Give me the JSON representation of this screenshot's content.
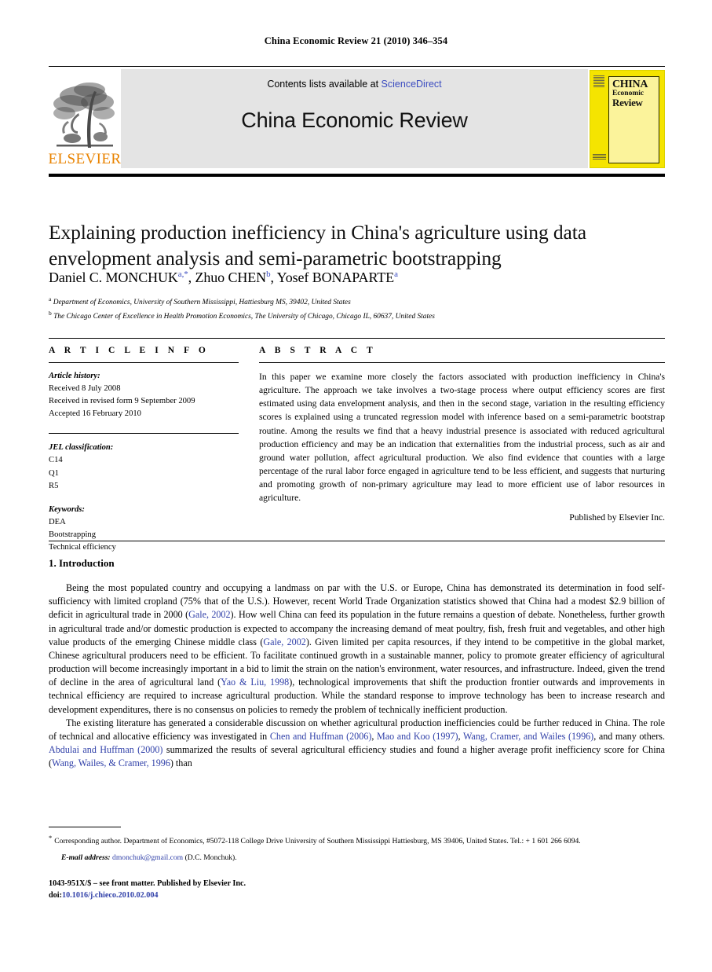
{
  "running_head": "China Economic Review 21 (2010) 346–354",
  "masthead": {
    "publisher_name": "ELSEVIER",
    "publisher_logo_icon": "elsevier-tree-icon",
    "contents_prefix": "Contents lists available at ",
    "contents_link": "ScienceDirect",
    "journal_name": "China Economic Review",
    "cover": {
      "line1": "CHINA",
      "line2": "Economic",
      "line3": "Review",
      "background_color": "#F5E400"
    }
  },
  "article": {
    "title": "Explaining production inefficiency in China's agriculture using data envelopment analysis and semi-parametric bootstrapping",
    "authors": [
      {
        "name": "Daniel C. MONCHUK",
        "marks": "a,*"
      },
      {
        "name": "Zhuo CHEN",
        "marks": "b"
      },
      {
        "name": "Yosef BONAPARTE",
        "marks": "a"
      }
    ],
    "affiliations": [
      {
        "mark": "a",
        "text": "Department of Economics, University of Southern Mississippi, Hattiesburg MS, 39402, United States"
      },
      {
        "mark": "b",
        "text": "The Chicago Center of Excellence in Health Promotion Economics, The University of Chicago, Chicago IL, 60637, United States"
      }
    ]
  },
  "info": {
    "heading": "A R T I C L E  I N F O",
    "history_label": "Article history:",
    "history": [
      "Received 8 July 2008",
      "Received in revised form 9 September 2009",
      "Accepted 16 February 2010"
    ],
    "jel_label": "JEL classification:",
    "jel_codes": [
      "C14",
      "Q1",
      "R5"
    ],
    "keywords_label": "Keywords:",
    "keywords": [
      "DEA",
      "Bootstrapping",
      "Technical efficiency"
    ]
  },
  "abstract": {
    "heading": "A B S T R A C T",
    "text": "In this paper we examine more closely the factors associated with production inefficiency in China's agriculture. The approach we take involves a two-stage process where output efficiency scores are first estimated using data envelopment analysis, and then in the second stage, variation in the resulting efficiency scores is explained using a truncated regression model with inference based on a semi-parametric bootstrap routine. Among the results we find that a heavy industrial presence is associated with reduced agricultural production efficiency and may be an indication that externalities from the industrial process, such as air and ground water pollution, affect agricultural production. We also find evidence that counties with a large percentage of the rural labor force engaged in agriculture tend to be less efficient, and suggests that nurturing and promoting growth of non-primary agriculture may lead to more efficient use of labor resources in agriculture.",
    "publisher_line": "Published by Elsevier Inc."
  },
  "body": {
    "section_heading": "1. Introduction",
    "paragraph1_a": "Being the most populated country and occupying a landmass on par with the U.S. or Europe, China has demonstrated its determination in food self-sufficiency with limited cropland (75% that of the U.S.). However, recent World Trade Organization statistics showed that China had a modest $2.9 billion of deficit in agricultural trade in 2000 (",
    "cite_gale_1": "Gale, 2002",
    "paragraph1_b": "). How well China can feed its population in the future remains a question of debate. Nonetheless, further growth in agricultural trade and/or domestic production is expected to accompany the increasing demand of meat poultry, fish, fresh fruit and vegetables, and other high value products of the emerging Chinese middle class (",
    "cite_gale_2": "Gale, 2002",
    "paragraph1_c": "). Given limited per capita resources, if they intend to be competitive in the global market, Chinese agricultural producers need to be efficient. To facilitate continued growth in a sustainable manner, policy to promote greater efficiency of agricultural production will become increasingly important in a bid to limit the strain on the nation's environment, water resources, and infrastructure. Indeed, given the trend of decline in the area of agricultural land (",
    "cite_yao_liu": "Yao & Liu, 1998",
    "paragraph1_d": "), technological improvements that shift the production frontier outwards and improvements in technical efficiency are required to increase agricultural production. While the standard response to improve technology has been to increase research and development expenditures, there is no consensus on policies to remedy the problem of technically inefficient production.",
    "paragraph2_a": "The existing literature has generated a considerable discussion on whether agricultural production inefficiencies could be further reduced in China. The role of technical and allocative efficiency was investigated in ",
    "cite_chen_huffman": "Chen and Huffman (2006)",
    "paragraph2_b": ", ",
    "cite_mao_koo": "Mao and Koo (1997)",
    "paragraph2_c": ", ",
    "cite_wang_cramer": "Wang, Cramer, and Wailes (1996)",
    "paragraph2_d": ", and many others. ",
    "cite_abdulai": "Abdulai and Huffman (2000)",
    "paragraph2_e": " summarized the results of several agricultural efficiency studies and found a higher average profit inefficiency score for China (",
    "cite_wang_wailes": "Wang, Wailes, & Cramer, 1996",
    "paragraph2_f": ") than"
  },
  "footnotes": {
    "star_mark": "*",
    "corresponding": "Corresponding author. Department of Economics, #5072-118 College Drive University of Southern Mississippi Hattiesburg, MS 39406, United States. Tel.: + 1 601 266 6094.",
    "email_label": "E-mail address:",
    "email": "dmonchuk@gmail.com",
    "email_suffix": "(D.C. Monchuk)."
  },
  "copyright": {
    "issn_line": "1043-951X/$ – see front matter. Published by Elsevier Inc.",
    "doi_label": "doi:",
    "doi_value": "10.1016/j.chieco.2010.02.004"
  }
}
